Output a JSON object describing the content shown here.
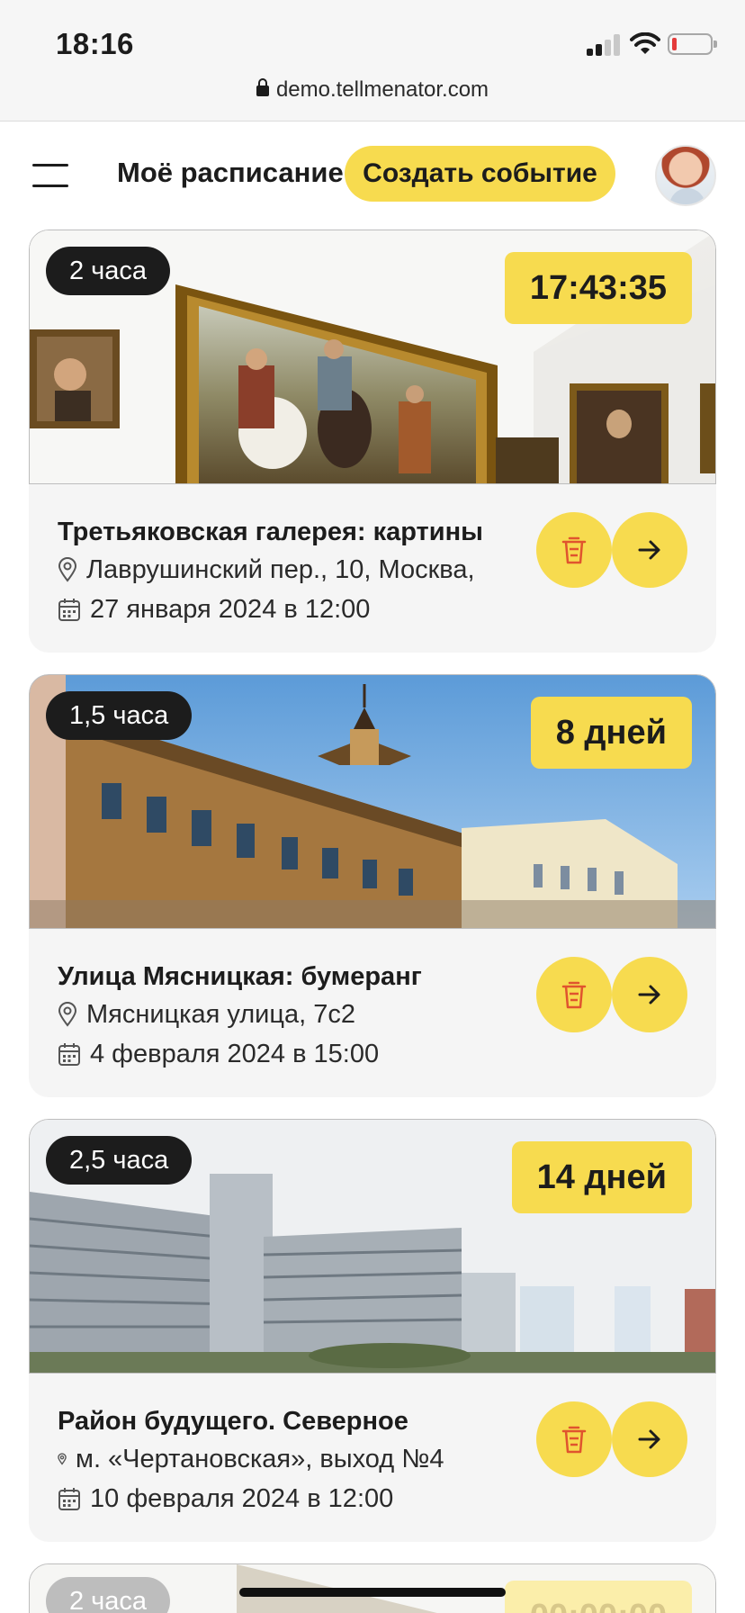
{
  "status_bar": {
    "time": "18:16",
    "url": "demo.tellmenator.com"
  },
  "header": {
    "title": "Моё расписание",
    "create_button": "Создать событие"
  },
  "events": [
    {
      "duration": "2 часа",
      "countdown": "17:43:35",
      "title": "Третьяковская галерея: картины",
      "address": "Лаврушинский пер., 10, Москва,",
      "datetime": "27 января 2024 в 12:00"
    },
    {
      "duration": "1,5 часа",
      "countdown": "8 дней",
      "title": "Улица Мясницкая: бумеранг",
      "address": "Мясницкая улица, 7с2",
      "datetime": "4 февраля 2024 в 15:00"
    },
    {
      "duration": "2,5 часа",
      "countdown": "14 дней",
      "title": "Район будущего. Северное",
      "address": "м. «Чертановская», выход №4",
      "datetime": "10 февраля 2024 в 12:00"
    },
    {
      "duration": "2 часа",
      "countdown": "00:00:00"
    }
  ],
  "colors": {
    "accent": "#f7db4f",
    "dark": "#1c1c1c",
    "card_bg": "#f5f5f5",
    "trash": "#e0542e"
  },
  "icons": {
    "menu": "hamburger-icon",
    "delete": "trash-icon",
    "open": "arrow-right-icon",
    "location": "pin-icon",
    "date": "calendar-icon"
  }
}
